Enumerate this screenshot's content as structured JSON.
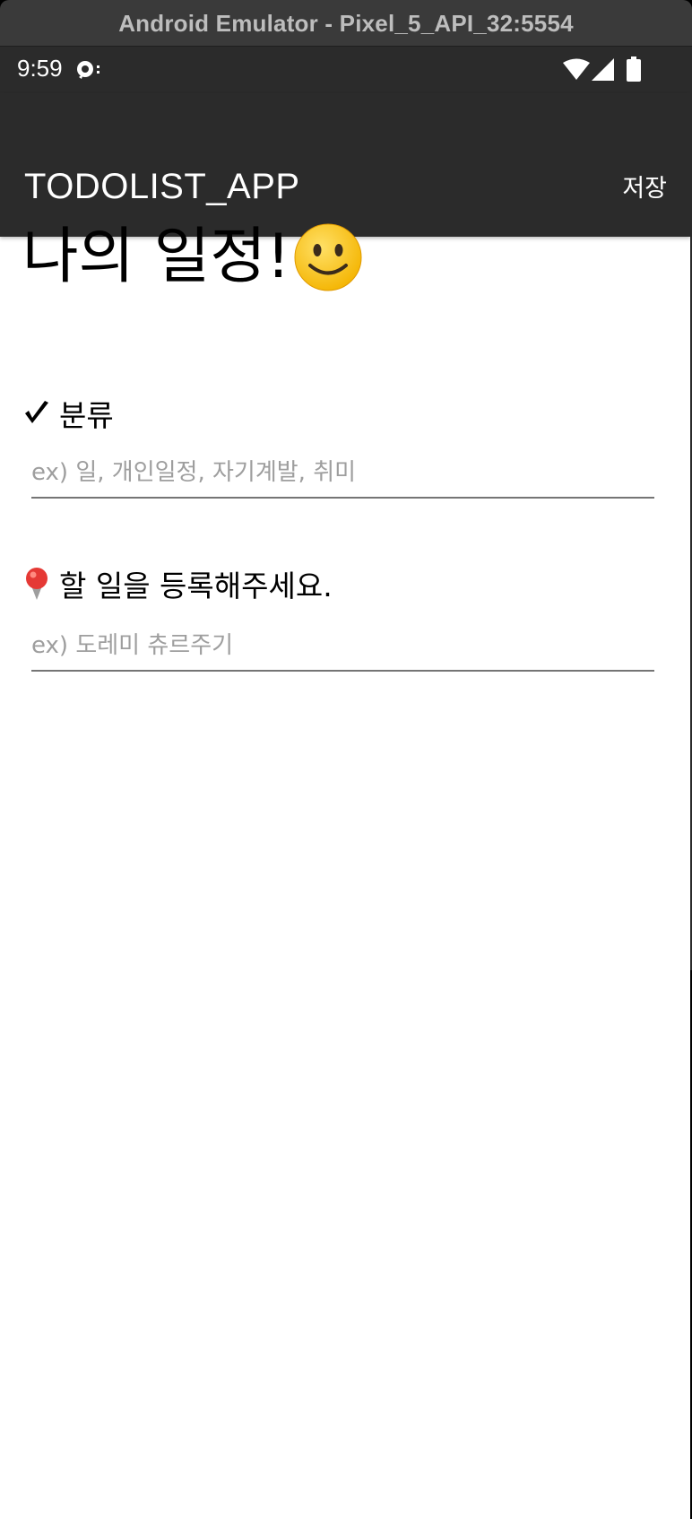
{
  "window": {
    "title": "Android Emulator - Pixel_5_API_32:5554"
  },
  "status_bar": {
    "time": "9:59",
    "icons": [
      "notification-icon",
      "wifi-icon",
      "cellular-signal-icon",
      "battery-icon"
    ]
  },
  "app_bar": {
    "title": "TODOLIST_APP",
    "action_label": "저장"
  },
  "content": {
    "heading": "나의 일정!",
    "heading_emoji": "smiley-face-icon",
    "category": {
      "label": "분류",
      "icon": "check-mark-icon",
      "placeholder": "ex) 일, 개인일정, 자기계발, 취미",
      "value": ""
    },
    "task": {
      "label": "할 일을 등록해주세요.",
      "icon": "pushpin-icon",
      "placeholder": "ex) 도레미 츄르주기",
      "value": ""
    }
  },
  "colors": {
    "app_bar_bg": "#2b2b2b",
    "title_bar_bg": "#3a3a3a",
    "content_bg": "#ffffff",
    "placeholder": "#9e9e9e",
    "underline": "#757575"
  }
}
